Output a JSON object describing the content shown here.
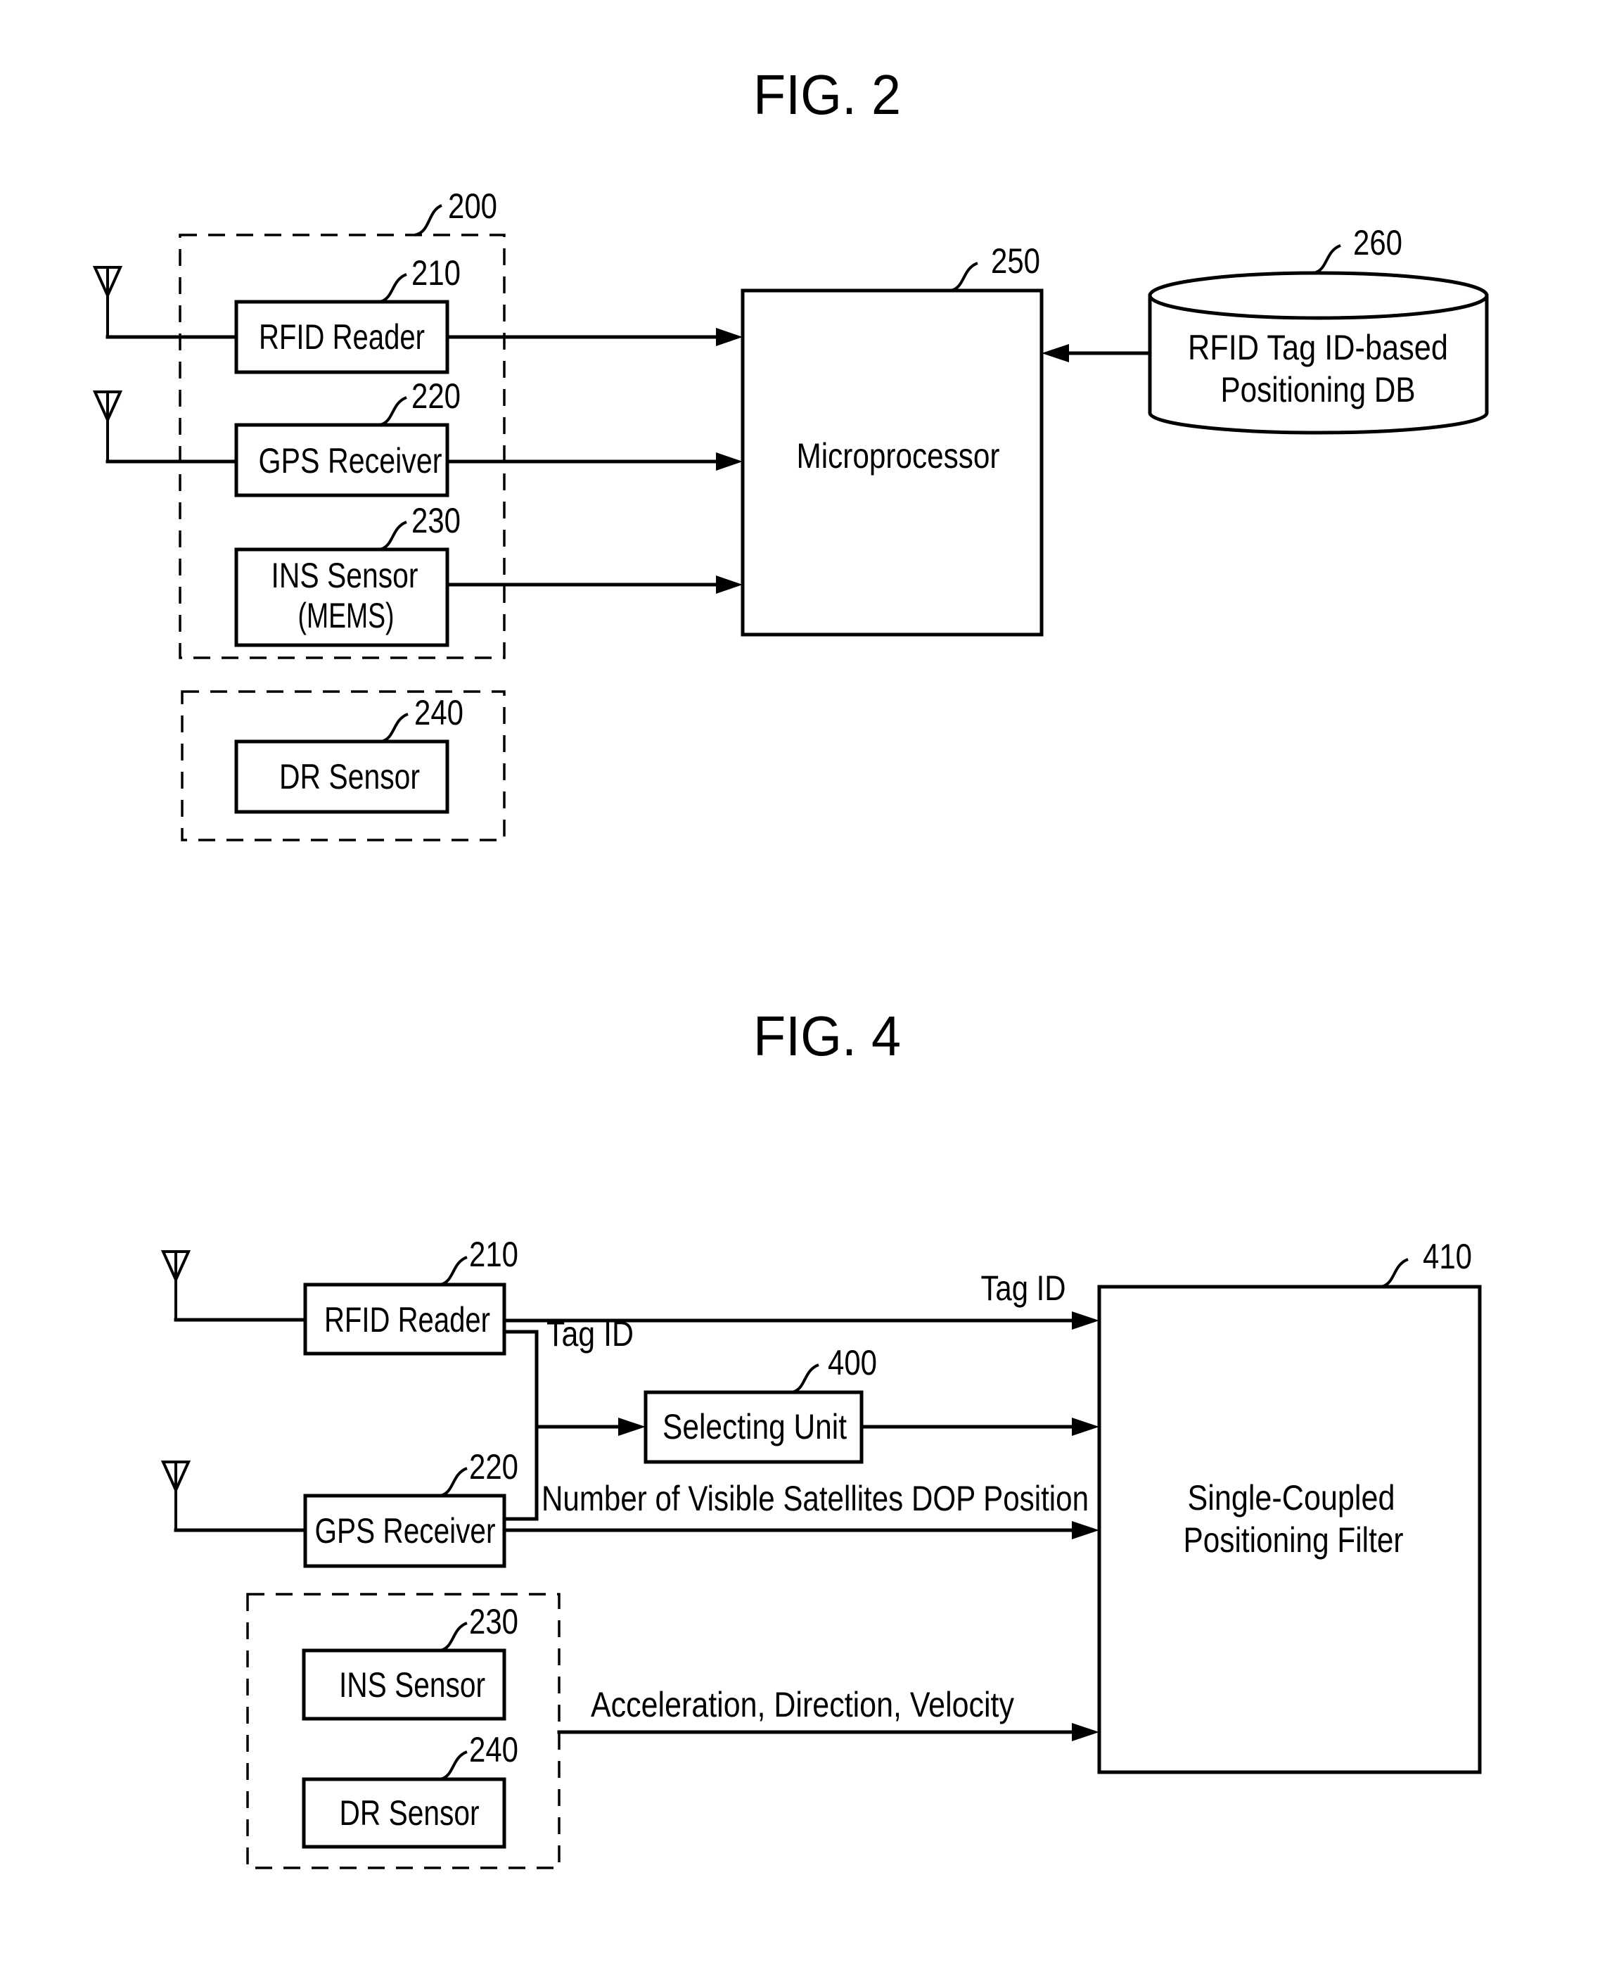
{
  "fig2": {
    "title": "FIG. 2",
    "group_ref": "200",
    "rfid_reader": {
      "label": "RFID Reader",
      "ref": "210"
    },
    "gps_receiver": {
      "label": "GPS Receiver",
      "ref": "220"
    },
    "ins_sensor": {
      "label_line1": "INS Sensor",
      "label_line2": "(MEMS)",
      "ref": "230"
    },
    "dr_sensor": {
      "label": "DR Sensor",
      "ref": "240"
    },
    "microprocessor": {
      "label": "Microprocessor",
      "ref": "250"
    },
    "database": {
      "label_line1": "RFID Tag ID-based",
      "label_line2": "Positioning DB",
      "ref": "260"
    }
  },
  "fig4": {
    "title": "FIG. 4",
    "rfid_reader": {
      "label": "RFID Reader",
      "ref": "210"
    },
    "gps_receiver": {
      "label": "GPS Receiver",
      "ref": "220"
    },
    "selecting_unit": {
      "label": "Selecting Unit",
      "ref": "400"
    },
    "filter": {
      "label_line1": "Single-Coupled",
      "label_line2": "Positioning Filter",
      "ref": "410"
    },
    "ins_sensor": {
      "label": "INS Sensor",
      "ref": "230"
    },
    "dr_sensor": {
      "label": "DR Sensor",
      "ref": "240"
    },
    "signals": {
      "tag_id_direct": "Tag ID",
      "tag_id_branch": "Tag ID",
      "gps_outputs": "Number of Visible Satellites DOP Position",
      "inertial_outputs": "Acceleration, Direction, Velocity"
    }
  }
}
